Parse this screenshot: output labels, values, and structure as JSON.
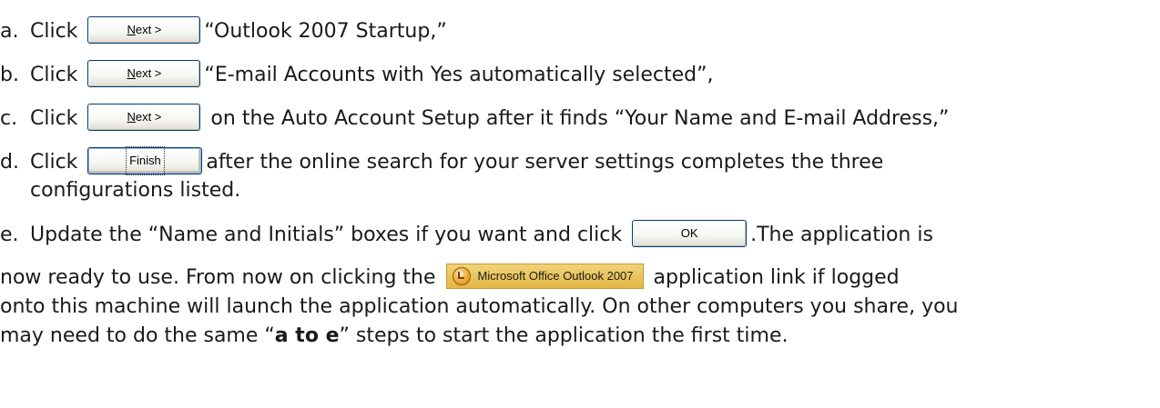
{
  "steps": [
    {
      "marker": "a.",
      "click_word": "Click",
      "button": {
        "label_underlined": "N",
        "label_rest": "ext >"
      },
      "text": "“Outlook 2007 Startup,”"
    },
    {
      "marker": "b.",
      "click_word": "Click",
      "button": {
        "label_underlined": "N",
        "label_rest": "ext >"
      },
      "text": "“E-mail Accounts with Yes automatically selected”,"
    },
    {
      "marker": "c.",
      "click_word": "Click",
      "button": {
        "label_underlined": "N",
        "label_rest": "ext >"
      },
      "text": "on the Auto Account Setup after it finds “Your Name and E-mail Address,”"
    },
    {
      "marker": "d.",
      "click_word": "Click",
      "button": {
        "label": "Finish"
      },
      "text": "after the online search for your server settings completes the three",
      "text_cont": "configurations listed."
    },
    {
      "marker": "e.",
      "text_before": "Update the “Name and Initials” boxes if you want and click",
      "button": {
        "label": "OK"
      },
      "text_after": ".The application is",
      "line2_before": "now ready to use. From now on clicking the",
      "link_badge": {
        "label": "Microsoft Office Outlook 2007",
        "icon": "outlook-icon"
      },
      "line2_after": "application link if logged",
      "line3": "onto this machine will launch the application automatically. On other computers you share, you",
      "line4_before": "may need to do the same “",
      "line4_bold": "a to e",
      "line4_after": "” steps to start the application the first time."
    }
  ]
}
